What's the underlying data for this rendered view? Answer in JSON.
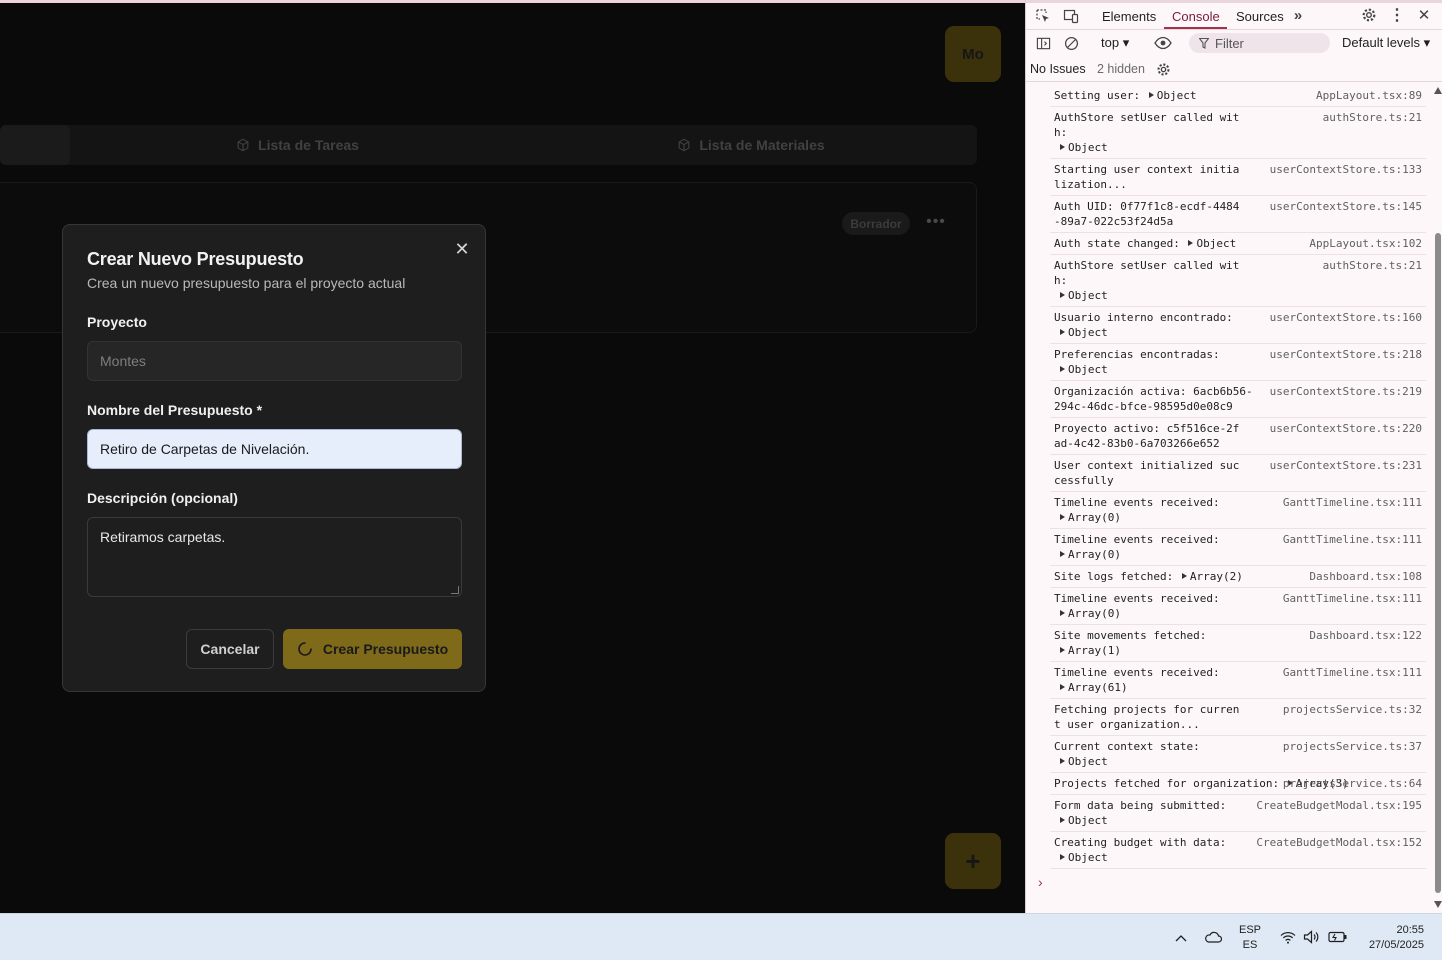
{
  "app": {
    "avatar_label": "Mo",
    "tabs": [
      {
        "label": ""
      },
      {
        "label": "Lista de Tareas",
        "icon": "cube-icon"
      },
      {
        "label": "Lista de Materiales",
        "icon": "cube-icon"
      }
    ],
    "card": {
      "status_badge": "Borrador",
      "menu_icon": "more-horizontal-icon"
    },
    "fab_label": "+"
  },
  "modal": {
    "title": "Crear Nuevo Presupuesto",
    "subtitle": "Crea un nuevo presupuesto para el proyecto actual",
    "project_label": "Proyecto",
    "project_value": "Montes",
    "name_label": "Nombre del Presupuesto *",
    "name_value": "Retiro de Carpetas de Nivelación.",
    "description_label": "Descripción (opcional)",
    "description_value": "Retiramos carpetas.",
    "cancel_label": "Cancelar",
    "create_label": "Crear Presupuesto",
    "close_icon": "close-icon",
    "accent_color": "#7f6a1a"
  },
  "devtools": {
    "tabs": [
      "Elements",
      "Console",
      "Sources"
    ],
    "active_tab": "Console",
    "context": "top",
    "filter_placeholder": "Filter",
    "levels": "Default levels",
    "issues": "No Issues",
    "hidden": "2 hidden",
    "logs": [
      {
        "msg": "Setting user: ",
        "obj": "Object",
        "inline": true,
        "src": "AppLayout.tsx:89"
      },
      {
        "msg": "AuthStore setUser called with:",
        "obj": "Object",
        "src": "authStore.ts:21"
      },
      {
        "msg": "Starting user context initialization...",
        "src": "userContextStore.ts:133"
      },
      {
        "msg": "Auth UID: 0f77f1c8-ecdf-4484-89a7-022c53f24d5a",
        "src": "userContextStore.ts:145"
      },
      {
        "msg": "Auth state changed: ",
        "obj": "Object",
        "inline": true,
        "src": "AppLayout.tsx:102"
      },
      {
        "msg": "AuthStore setUser called with:",
        "obj": "Object",
        "src": "authStore.ts:21"
      },
      {
        "msg": "Usuario interno encontrado:",
        "obj": "Object",
        "src": "userContextStore.ts:160"
      },
      {
        "msg": "Preferencias encontradas:",
        "obj": "Object",
        "src": "userContextStore.ts:218"
      },
      {
        "msg": "Organización activa: 6acb6b56-294c-46dc-bfce-98595d0e08c9",
        "src": "userContextStore.ts:219",
        "wide": true
      },
      {
        "msg": "Proyecto activo: c5f516ce-2fad-4c42-83b0-6a703266e652",
        "src": "userContextStore.ts:220"
      },
      {
        "msg": "User context initialized successfully",
        "src": "userContextStore.ts:231"
      },
      {
        "msg": "Timeline events received:",
        "obj": "Array(0)",
        "src": "GanttTimeline.tsx:111"
      },
      {
        "msg": "Timeline events received:",
        "obj": "Array(0)",
        "src": "GanttTimeline.tsx:111"
      },
      {
        "msg": "Site logs fetched: ",
        "obj": "Array(2)",
        "inline": true,
        "src": "Dashboard.tsx:108"
      },
      {
        "msg": "Timeline events received:",
        "obj": "Array(0)",
        "src": "GanttTimeline.tsx:111"
      },
      {
        "msg": "Site movements fetched:",
        "obj": "Array(1)",
        "src": "Dashboard.tsx:122"
      },
      {
        "msg": "Timeline events received:",
        "obj": "Array(61)",
        "src": "GanttTimeline.tsx:111"
      },
      {
        "msg": "Fetching projects for current user organization...",
        "src": "projectsService.ts:32"
      },
      {
        "msg": "Current context state:",
        "obj": "Object",
        "src": "projectsService.ts:37"
      },
      {
        "msg": "Projects fetched for organization: ",
        "obj": "Array(3)",
        "inline": true,
        "src": "projectsService.ts:64"
      },
      {
        "msg": "Form data being submitted:",
        "obj": "Object",
        "src": "CreateBudgetModal.tsx:195"
      },
      {
        "msg": "Creating budget with data:",
        "obj": "Object",
        "src": "CreateBudgetModal.tsx:152"
      }
    ],
    "prompt": "›"
  },
  "taskbar": {
    "lang_line1": "ESP",
    "lang_line2": "ES",
    "time": "20:55",
    "date": "27/05/2025"
  }
}
